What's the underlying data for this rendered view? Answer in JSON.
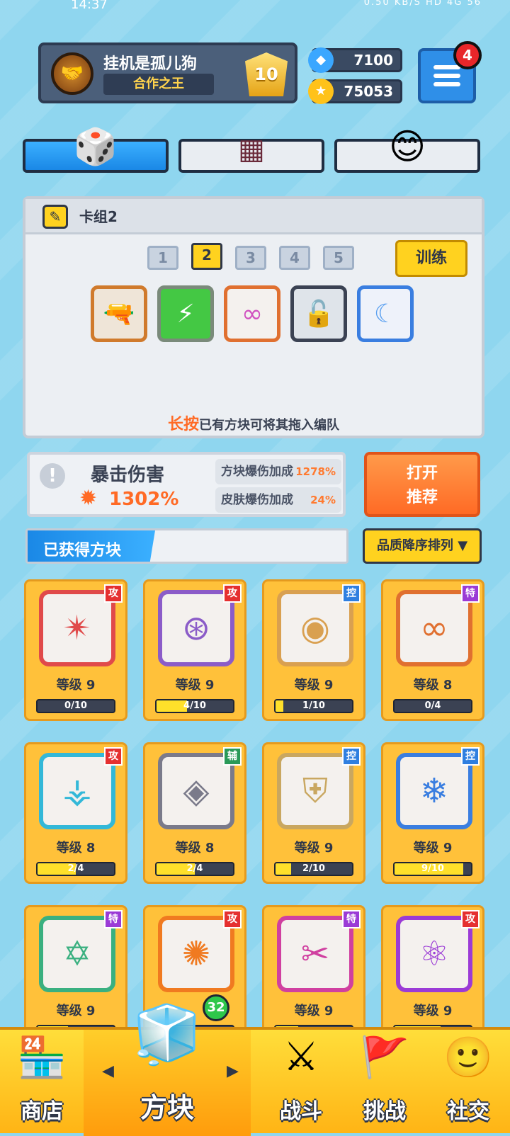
{
  "status_bar": {
    "time": "14:37",
    "indicators": "0.50 KB/S  HD  4G  56"
  },
  "profile": {
    "name": "挂机是孤儿狗",
    "title": "合作之王",
    "rank": "10",
    "avatar_icon": "handshake-icon"
  },
  "currency": {
    "gems": "7100",
    "coins": "75053"
  },
  "menu": {
    "badge": "4"
  },
  "category_tabs": [
    {
      "icon": "dice-icon"
    },
    {
      "icon": "grid-icon"
    },
    {
      "icon": "smile-icon"
    }
  ],
  "deck": {
    "title": "卡组2",
    "tabs": [
      "1",
      "2",
      "3",
      "4",
      "5"
    ],
    "selected_tab": "2",
    "train_label": "训练",
    "slots": [
      {
        "icon": "gun-icon"
      },
      {
        "icon": "lightning-icon"
      },
      {
        "icon": "infinity-icon"
      },
      {
        "icon": "lock-icon"
      },
      {
        "icon": "moon-icon"
      }
    ],
    "hint_highlight": "长按",
    "hint_text": "已有方块可将其拖入编队"
  },
  "crit": {
    "label": "暴击伤害",
    "value": "1302%",
    "bonuses": [
      {
        "label": "方块爆伤加成",
        "value": "1278%"
      },
      {
        "label": "皮肤爆伤加成",
        "value": "24%"
      }
    ]
  },
  "recommend_label": "打开\n推荐",
  "obtained": {
    "label": "已获得方块",
    "sort_label": "品质降序排列 ▼"
  },
  "cards": [
    {
      "tag": "攻",
      "tag_color": "#e53030",
      "level": "等级 9",
      "progress": "0/10",
      "fill": 0.0,
      "glyph": "✴",
      "color": "#e04a4a"
    },
    {
      "tag": "攻",
      "tag_color": "#e53030",
      "level": "等级 9",
      "progress": "4/10",
      "fill": 0.4,
      "glyph": "⊛",
      "color": "#8b5cc8"
    },
    {
      "tag": "控",
      "tag_color": "#2f7fe0",
      "level": "等级 9",
      "progress": "1/10",
      "fill": 0.1,
      "glyph": "◉",
      "color": "#d9a050"
    },
    {
      "tag": "特",
      "tag_color": "#9b3bd6",
      "level": "等级 8",
      "progress": "0/4",
      "fill": 0.0,
      "glyph": "∞",
      "color": "#e07030"
    },
    {
      "tag": "攻",
      "tag_color": "#e53030",
      "level": "等级 8",
      "progress": "2/4",
      "fill": 0.5,
      "glyph": "⚶",
      "color": "#33b8d8"
    },
    {
      "tag": "辅",
      "tag_color": "#2a9a58",
      "level": "等级 8",
      "progress": "2/4",
      "fill": 0.5,
      "glyph": "◈",
      "color": "#7a7a8a"
    },
    {
      "tag": "控",
      "tag_color": "#2f7fe0",
      "level": "等级 9",
      "progress": "2/10",
      "fill": 0.2,
      "glyph": "⛨",
      "color": "#c9a760"
    },
    {
      "tag": "控",
      "tag_color": "#2f7fe0",
      "level": "等级 9",
      "progress": "9/10",
      "fill": 0.9,
      "glyph": "❄",
      "color": "#3a7ee0"
    },
    {
      "tag": "特",
      "tag_color": "#9b3bd6",
      "level": "等级 9",
      "progress": "",
      "fill": 0.4,
      "glyph": "✡",
      "color": "#3ab080"
    },
    {
      "tag": "攻",
      "tag_color": "#e53030",
      "level": "",
      "progress": "",
      "fill": 0.5,
      "glyph": "✺",
      "color": "#f07a20"
    },
    {
      "tag": "特",
      "tag_color": "#9b3bd6",
      "level": "等级 9",
      "progress": "",
      "fill": 0.3,
      "glyph": "✂",
      "color": "#d040a0"
    },
    {
      "tag": "攻",
      "tag_color": "#e53030",
      "level": "等级 9",
      "progress": "",
      "fill": 0.6,
      "glyph": "⚛",
      "color": "#9b3bd6"
    }
  ],
  "nav": {
    "items": [
      {
        "label": "商店",
        "icon": "shop-icon"
      },
      {
        "label": "方块",
        "icon": "cube-icon"
      },
      {
        "label": "战斗",
        "icon": "sword-icon"
      },
      {
        "label": "挑战",
        "icon": "flag-icon"
      },
      {
        "label": "社交",
        "icon": "avatar-icon"
      }
    ],
    "new_count": "32"
  }
}
